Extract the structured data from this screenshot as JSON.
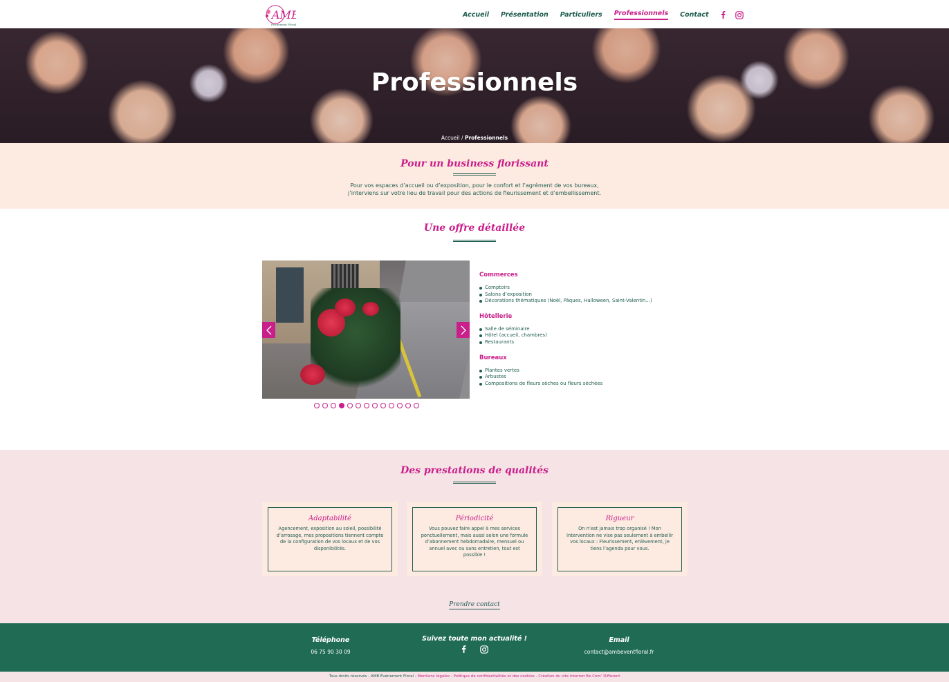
{
  "brand": {
    "logo_text": "AMB",
    "tagline": "Événement Floral"
  },
  "nav": {
    "items": [
      {
        "label": "Accueil",
        "active": false
      },
      {
        "label": "Présentation",
        "active": false
      },
      {
        "label": "Particuliers",
        "active": false
      },
      {
        "label": "Professionnels",
        "active": true
      },
      {
        "label": "Contact",
        "active": false
      }
    ],
    "social": [
      "facebook-icon",
      "instagram-icon"
    ]
  },
  "hero": {
    "title": "Professionnels",
    "breadcrumb": {
      "home": "Accueil",
      "separator": " / ",
      "current": "Professionnels"
    }
  },
  "intro": {
    "title": "Pour un business florissant",
    "line1": "Pour vos espaces d’accueil ou d’exposition, pour le confort et l’agrément de vos bureaux,",
    "line2": "j’interviens sur votre lieu de travail pour des actions de fleurissement et d’embellissement."
  },
  "offer": {
    "title": "Une offre détaillée",
    "slider": {
      "slide_count": 13,
      "active_index": 3
    },
    "categories": [
      {
        "name": "Commerces",
        "items": [
          "Comptoirs",
          "Salons d’exposition",
          "Décorations thématiques (Noël, Pâques, Halloween, Saint-Valentin...)"
        ]
      },
      {
        "name": "Hôtellerie",
        "items": [
          "Salle de séminaire",
          "Hôtel (accueil, chambres)",
          "Restaurants"
        ]
      },
      {
        "name": "Bureaux",
        "items": [
          "Plantes vertes",
          "Arbustes",
          "Compositions de fleurs sèches ou fleurs séchées"
        ]
      }
    ]
  },
  "prestations": {
    "title": "Des prestations de qualités",
    "cards": [
      {
        "title": "Adaptabilité",
        "text": "Agencement, exposition au soleil, possibilité d’arrosage, mes propositions tiennent compte de la configuration de vos locaux et de vos disponibilités."
      },
      {
        "title": "Périodicité",
        "text": "Vous pouvez faire appel à mes services ponctuellement, mais aussi selon une formule d’abonnement hebdomadaire, mensuel ou annuel avec ou sans entretien, tout est possible !"
      },
      {
        "title": "Rigueur",
        "text": "On n’est jamais trop organisé ! Mon intervention ne vise pas seulement à embellir vos locaux : Fleurissement, enlèvement, je tiens l’agenda pour vous."
      }
    ],
    "contact_label": "Prendre contact"
  },
  "footer": {
    "phone_title": "Téléphone",
    "phone": "06 75 90 30 09",
    "social_title": "Suivez toute mon actualité !",
    "email_title": "Email",
    "email": "contact@ambeventfloral.fr"
  },
  "bottom": {
    "rights": "Tous droits réservés - AMB Événement Floral - ",
    "legal": "Mentions légales",
    "sep": " - ",
    "privacy": "Politique de confidentialités et des cookies",
    "creation": "Création du site internet Be Com’ Different"
  },
  "colors": {
    "pink": "#c91f8a",
    "green": "#1f5d4f",
    "footer_green": "#1f6b54",
    "peach": "#fdeae1",
    "rose": "#f6e3e6"
  }
}
